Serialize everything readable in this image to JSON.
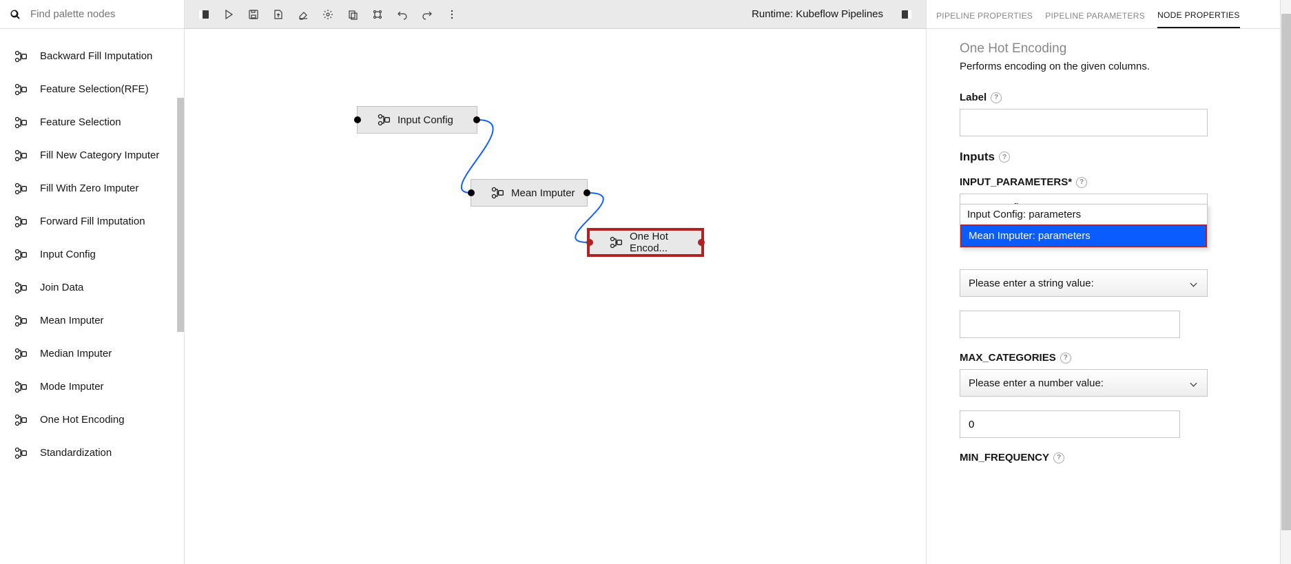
{
  "search": {
    "placeholder": "Find palette nodes"
  },
  "palette": {
    "items": [
      "Backward Fill Imputation",
      "Feature Selection(RFE)",
      "Feature Selection",
      "Fill New Category Imputer",
      "Fill With Zero Imputer",
      "Forward Fill Imputation",
      "Input Config",
      "Join Data",
      "Mean Imputer",
      "Median Imputer",
      "Mode Imputer",
      "One Hot Encoding",
      "Standardization"
    ]
  },
  "toolbar": {
    "runtime": "Runtime: Kubeflow Pipelines"
  },
  "canvas": {
    "nodes": {
      "input_config": "Input Config",
      "mean_imputer": "Mean Imputer",
      "one_hot": "One Hot Encod..."
    }
  },
  "tabs": {
    "pipeline_props": "PIPELINE PROPERTIES",
    "pipeline_params": "PIPELINE PARAMETERS",
    "node_props": "NODE PROPERTIES"
  },
  "panel": {
    "title": "One Hot Encoding",
    "desc": "Performs encoding on the given columns.",
    "label_field": "Label",
    "inputs_section": "Inputs",
    "input_params_label": "INPUT_PARAMETERS*",
    "input_params_value": "Input Config: parameters",
    "dropdown": {
      "opt1": "Input Config: parameters",
      "opt2": "Mean Imputer: parameters"
    },
    "string_placeholder": "Please enter a string value:",
    "max_cat_label": "MAX_CATEGORIES",
    "number_placeholder": "Please enter a number value:",
    "number_value": "0",
    "min_freq_label": "MIN_FREQUENCY"
  }
}
